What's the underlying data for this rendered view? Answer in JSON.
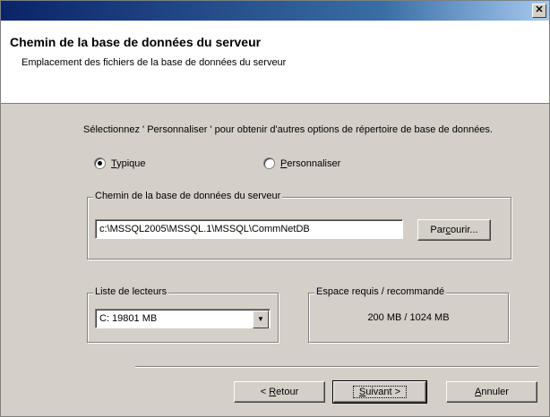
{
  "header": {
    "title": "Chemin de la base de données du serveur",
    "subtitle": "Emplacement des fichiers de la base de données du serveur"
  },
  "intro": "Sélectionnez ' Personnaliser ' pour obtenir d'autres options de répertoire de base de données.",
  "radios": [
    {
      "mnemonic": "T",
      "rest": "ypique",
      "selected": true
    },
    {
      "mnemonic": "P",
      "rest": "ersonnaliser",
      "selected": false
    }
  ],
  "path_group": {
    "label": "Chemin de la base de données du serveur",
    "value": "c:\\MSSQL2005\\MSSQL.1\\MSSQL\\CommNetDB",
    "browse_pre": "Par",
    "browse_mnemonic": "c",
    "browse_post": "ourir..."
  },
  "drives_group": {
    "label": "Liste de lecteurs",
    "selected": "C:   19801 MB"
  },
  "space_group": {
    "label": "Espace requis / recommandé",
    "value": "200 MB / 1024 MB"
  },
  "buttons": {
    "back_pre": "< ",
    "back_mnemonic": "R",
    "back_post": "etour",
    "next_mnemonic": "S",
    "next_post": "uivant >",
    "cancel_mnemonic": "A",
    "cancel_post": "nnuler"
  }
}
